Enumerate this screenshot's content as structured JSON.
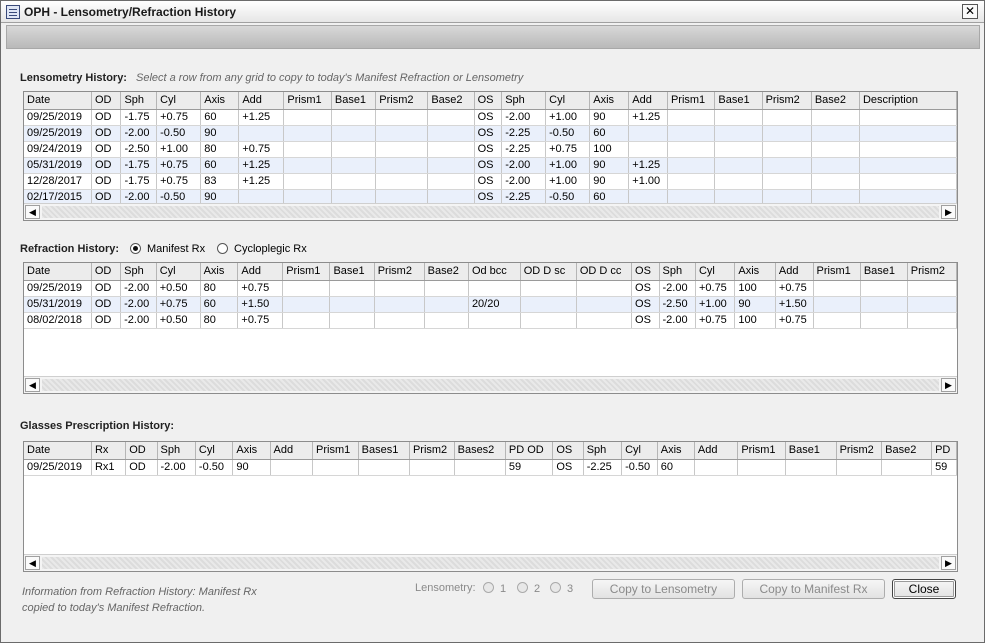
{
  "window": {
    "title": "OPH - Lensometry/Refraction History",
    "close_glyph": "✕"
  },
  "lensometry": {
    "label": "Lensometry History:",
    "hint": "Select  a row from any grid to copy to today's Manifest Refraction or Lensometry",
    "columns": [
      "Date",
      "OD",
      "Sph",
      "Cyl",
      "Axis",
      "Add",
      "Prism1",
      "Base1",
      "Prism2",
      "Base2",
      "OS",
      "Sph",
      "Cyl",
      "Axis",
      "Add",
      "Prism1",
      "Base1",
      "Prism2",
      "Base2",
      "Description"
    ],
    "rows": [
      [
        "09/25/2019",
        "OD",
        "-1.75",
        "+0.75",
        "60",
        "+1.25",
        "",
        "",
        "",
        "",
        "OS",
        "-2.00",
        "+1.00",
        "90",
        "+1.25",
        "",
        "",
        "",
        "",
        ""
      ],
      [
        "09/25/2019",
        "OD",
        "-2.00",
        "-0.50",
        "90",
        "",
        "",
        "",
        "",
        "",
        "OS",
        "-2.25",
        "-0.50",
        "60",
        "",
        "",
        "",
        "",
        "",
        ""
      ],
      [
        "09/24/2019",
        "OD",
        "-2.50",
        "+1.00",
        "80",
        "+0.75",
        "",
        "",
        "",
        "",
        "OS",
        "-2.25",
        "+0.75",
        "100",
        "",
        "",
        "",
        "",
        "",
        ""
      ],
      [
        "05/31/2019",
        "OD",
        "-1.75",
        "+0.75",
        "60",
        "+1.25",
        "",
        "",
        "",
        "",
        "OS",
        "-2.00",
        "+1.00",
        "90",
        "+1.25",
        "",
        "",
        "",
        "",
        ""
      ],
      [
        "12/28/2017",
        "OD",
        "-1.75",
        "+0.75",
        "83",
        "+1.25",
        "",
        "",
        "",
        "",
        "OS",
        "-2.00",
        "+1.00",
        "90",
        "+1.00",
        "",
        "",
        "",
        "",
        ""
      ],
      [
        "02/17/2015",
        "OD",
        "-2.00",
        "-0.50",
        "90",
        "",
        "",
        "",
        "",
        "",
        "OS",
        "-2.25",
        "-0.50",
        "60",
        "",
        "",
        "",
        "",
        "",
        ""
      ]
    ]
  },
  "refraction": {
    "label": "Refraction History:",
    "options": [
      "Manifest Rx",
      "Cycloplegic Rx"
    ],
    "selected": "Manifest Rx",
    "columns": [
      "Date",
      "OD",
      "Sph",
      "Cyl",
      "Axis",
      "Add",
      "Prism1",
      "Base1",
      "Prism2",
      "Base2",
      "Od bcc",
      "OD D sc",
      "OD D cc",
      "OS",
      "Sph",
      "Cyl",
      "Axis",
      "Add",
      "Prism1",
      "Base1",
      "Prism2"
    ],
    "rows": [
      [
        "09/25/2019",
        "OD",
        "-2.00",
        "+0.50",
        "80",
        "+0.75",
        "",
        "",
        "",
        "",
        "",
        "",
        "",
        "OS",
        "-2.00",
        "+0.75",
        "100",
        "+0.75",
        "",
        "",
        ""
      ],
      [
        "05/31/2019",
        "OD",
        "-2.00",
        "+0.75",
        "60",
        "+1.50",
        "",
        "",
        "",
        "",
        "20/20",
        "",
        "",
        "OS",
        "-2.50",
        "+1.00",
        "90",
        "+1.50",
        "",
        "",
        ""
      ],
      [
        "08/02/2018",
        "OD",
        "-2.00",
        "+0.50",
        "80",
        "+0.75",
        "",
        "",
        "",
        "",
        "",
        "",
        "",
        "OS",
        "-2.00",
        "+0.75",
        "100",
        "+0.75",
        "",
        "",
        ""
      ]
    ]
  },
  "glasses": {
    "label": "Glasses Prescription History:",
    "columns": [
      "Date",
      "Rx",
      "OD",
      "Sph",
      "Cyl",
      "Axis",
      "Add",
      "Prism1",
      "Bases1",
      "Prism2",
      "Bases2",
      "PD OD",
      "OS",
      "Sph",
      "Cyl",
      "Axis",
      "Add",
      "Prism1",
      "Base1",
      "Prism2",
      "Base2",
      "PD"
    ],
    "rows": [
      [
        "09/25/2019",
        "Rx1",
        "OD",
        "-2.00",
        "-0.50",
        "90",
        "",
        "",
        "",
        "",
        "",
        "59",
        "OS",
        "-2.25",
        "-0.50",
        "60",
        "",
        "",
        "",
        "",
        "",
        "59"
      ]
    ]
  },
  "footer": {
    "info_line1": "Information from Refraction History: Manifest Rx",
    "info_line2": "copied to today's Manifest Refraction.",
    "lensometry_label": "Lensometry:",
    "lensometry_options": [
      "1",
      "2",
      "3"
    ],
    "copy_lensometry": "Copy to Lensometry",
    "copy_manifest": "Copy to Manifest Rx",
    "close": "Close"
  },
  "scroll": {
    "left": "◀",
    "right": "▶"
  }
}
